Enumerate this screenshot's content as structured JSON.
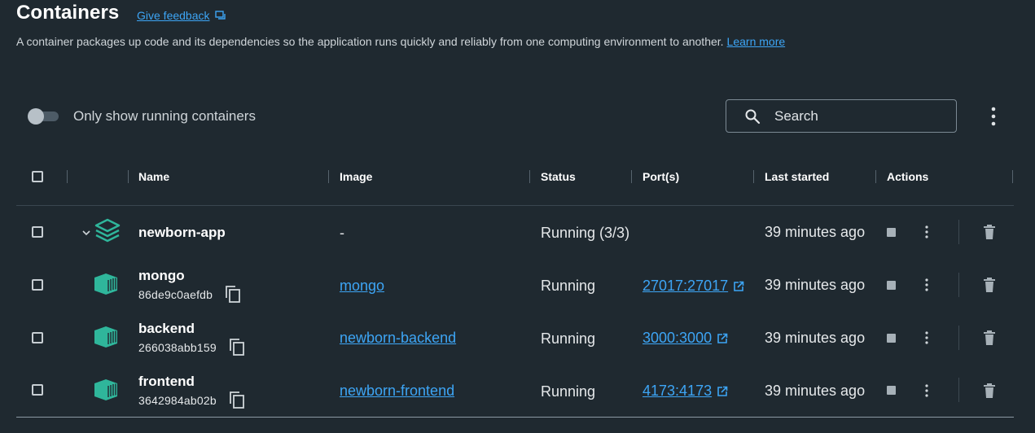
{
  "header": {
    "title": "Containers",
    "feedback_label": "Give feedback",
    "description": "A container packages up code and its dependencies so the application runs quickly and reliably from one computing environment to another.",
    "learn_more": "Learn more"
  },
  "toolbar": {
    "toggle_label": "Only show running containers",
    "toggle_on": false,
    "search_placeholder": "Search"
  },
  "table": {
    "columns": [
      "Name",
      "Image",
      "Status",
      "Port(s)",
      "Last started",
      "Actions"
    ],
    "group": {
      "name": "newborn-app",
      "image": "-",
      "status": "Running (3/3)",
      "last_started": "39 minutes ago"
    },
    "rows": [
      {
        "name": "mongo",
        "id": "86de9c0aefdb",
        "image": "mongo",
        "status": "Running",
        "ports": "27017:27017",
        "last_started": "39 minutes ago"
      },
      {
        "name": "backend",
        "id": "266038abb159",
        "image": "newborn-backend",
        "status": "Running",
        "ports": "3000:3000",
        "last_started": "39 minutes ago"
      },
      {
        "name": "frontend",
        "id": "3642984ab02b",
        "image": "newborn-frontend",
        "status": "Running",
        "ports": "4173:4173",
        "last_started": "39 minutes ago"
      }
    ]
  },
  "colors": {
    "accent": "#3da5f5",
    "container_icon": "#2fb69b",
    "background": "#1f2930"
  },
  "icons": [
    "feedback-icon",
    "search-icon",
    "more-vertical-icon",
    "chevron-down-icon",
    "stack-icon",
    "container-icon",
    "copy-icon",
    "external-link-icon",
    "stop-icon",
    "trash-icon"
  ]
}
